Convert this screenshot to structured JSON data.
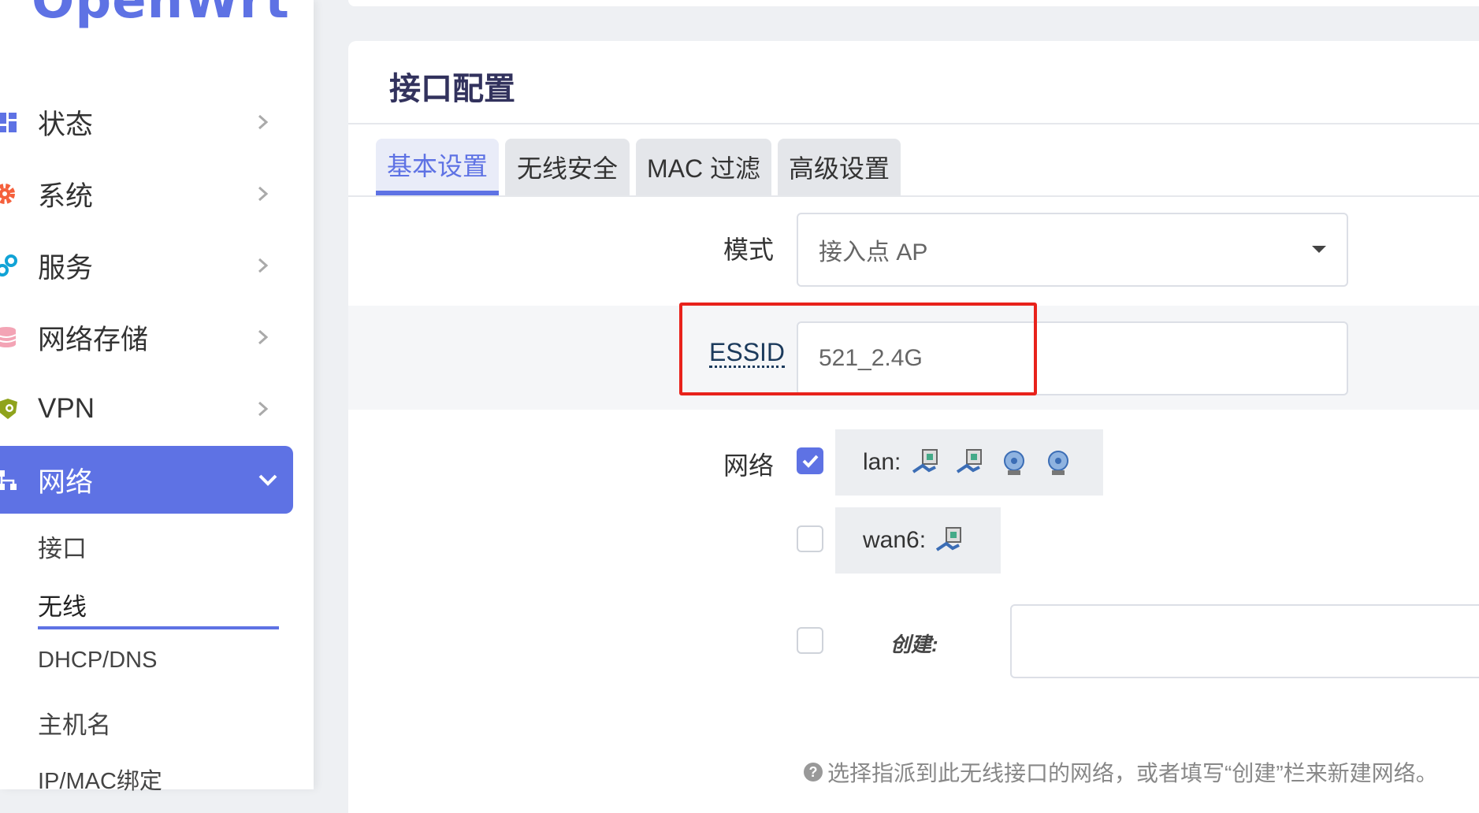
{
  "sidebar": {
    "logo": "OpenWrt",
    "items": [
      {
        "label": "状态",
        "icon": "dashboard-icon"
      },
      {
        "label": "系统",
        "icon": "gear-icon"
      },
      {
        "label": "服务",
        "icon": "cogs-icon"
      },
      {
        "label": "网络存储",
        "icon": "database-icon"
      },
      {
        "label": "VPN",
        "icon": "vpn-shield-icon"
      },
      {
        "label": "网络",
        "icon": "network-tree-icon"
      }
    ],
    "subitems": [
      "接口",
      "无线",
      "DHCP/DNS",
      "主机名",
      "IP/MAC绑定"
    ]
  },
  "card": {
    "title": "接口配置",
    "tabs": [
      "基本设置",
      "无线安全",
      "MAC 过滤",
      "高级设置"
    ]
  },
  "form": {
    "mode_label": "模式",
    "mode_value": "接入点 AP",
    "essid_label": "ESSID",
    "essid_value": "521_2.4G",
    "network_label": "网络",
    "lan_label": "lan:",
    "wan6_label": "wan6:",
    "create_label": "创建:",
    "create_value": "",
    "help": "选择指派到此无线接口的网络，或者填写“创建”栏来新建网络。"
  },
  "colors": {
    "accent": "#5e72e4",
    "highlight": "#e8221b"
  }
}
